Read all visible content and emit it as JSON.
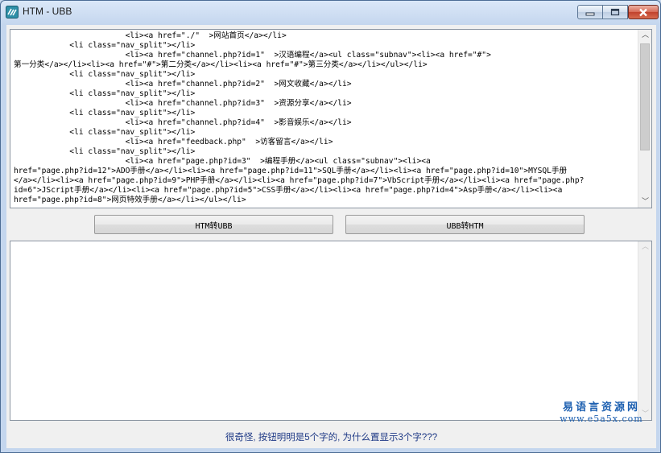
{
  "window": {
    "title": "HTM - UBB",
    "buttons": {
      "minimize": "minimize",
      "maximize": "maximize",
      "close": "close"
    }
  },
  "input_editor": {
    "text": "                        <li><a href=\"./\"  >网站首页</a></li>\n            <li class=\"nav_split\"></li>\n                        <li><a href=\"channel.php?id=1\"  >汉语编程</a><ul class=\"subnav\"><li><a href=\"#\">\n第一分类</a></li><li><a href=\"#\">第二分类</a></li><li><a href=\"#\">第三分类</a></li></ul></li>\n            <li class=\"nav_split\"></li>\n                        <li><a href=\"channel.php?id=2\"  >网文收藏</a></li>\n            <li class=\"nav_split\"></li>\n                        <li><a href=\"channel.php?id=3\"  >资源分享</a></li>\n            <li class=\"nav_split\"></li>\n                        <li><a href=\"channel.php?id=4\"  >影音娱乐</a></li>\n            <li class=\"nav_split\"></li>\n                        <li><a href=\"feedback.php\"  >访客留言</a></li>\n            <li class=\"nav_split\"></li>\n                        <li><a href=\"page.php?id=3\"  >编程手册</a><ul class=\"subnav\"><li><a\nhref=\"page.php?id=12\">ADO手册</a></li><li><a href=\"page.php?id=11\">SQL手册</a></li><li><a href=\"page.php?id=10\">MYSQL手册\n</a></li><li><a href=\"page.php?id=9\">PHP手册</a></li><li><a href=\"page.php?id=7\">VbScript手册</a></li><li><a href=\"page.php?\nid=6\">JScript手册</a></li><li><a href=\"page.php?id=5\">CSS手册</a></li><li><a href=\"page.php?id=4\">Asp手册</a></li><li><a\nhref=\"page.php?id=8\">网页特效手册</a></li></ul></li>"
  },
  "buttons": {
    "htm_to_ubb": "HTM转UBB",
    "ubb_to_htm": "UBB转HTM"
  },
  "output_editor": {
    "text": ""
  },
  "status": {
    "text": "很奇怪, 按钮明明是5个字的, 为什么置显示3个字???"
  },
  "watermark": {
    "chinese": "易语言资源网",
    "url": "www.e5a5x.com"
  },
  "colors": {
    "title_bar": "#c4d6ee",
    "close_button": "#c0422d",
    "status_text": "#1f3a86",
    "watermark": "#1c5fb0"
  },
  "icons": {
    "app": "app-logo-icon",
    "minimize": "minimize-icon",
    "maximize": "maximize-icon",
    "close": "close-icon"
  }
}
